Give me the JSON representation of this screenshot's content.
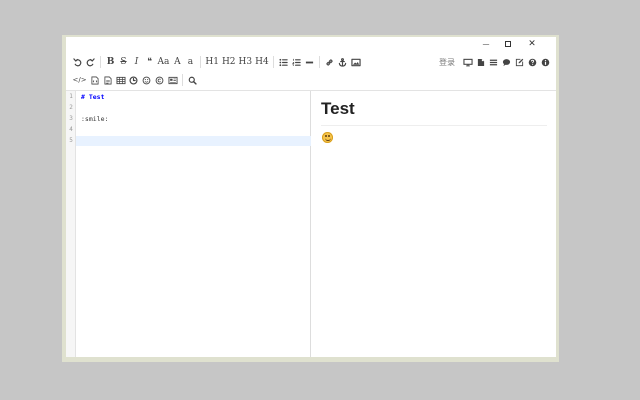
{
  "window": {
    "controls": {
      "minimize": "—",
      "close": "✕"
    }
  },
  "toolbar": {
    "row1": [
      {
        "name": "undo-button",
        "icon": "undo-icon"
      },
      {
        "name": "redo-button",
        "icon": "redo-icon"
      },
      {
        "sep": true
      },
      {
        "name": "bold-button",
        "label": "B",
        "style": "bold serif"
      },
      {
        "name": "strikethrough-button",
        "label": "S",
        "style": "strike serif"
      },
      {
        "name": "italic-button",
        "label": "I",
        "style": "italic serif"
      },
      {
        "name": "quote-button",
        "label": "❝",
        "style": ""
      },
      {
        "name": "uppercase-button",
        "label": "Aa",
        "style": "serif"
      },
      {
        "name": "capitalize-button",
        "label": "A",
        "style": "serif"
      },
      {
        "name": "lowercase-button",
        "label": "a",
        "style": "serif"
      },
      {
        "sep": true
      },
      {
        "name": "h1-button",
        "label": "H1",
        "style": "serif"
      },
      {
        "name": "h2-button",
        "label": "H2",
        "style": "serif"
      },
      {
        "name": "h3-button",
        "label": "H3",
        "style": "serif"
      },
      {
        "name": "h4-button",
        "label": "H4",
        "style": "serif"
      },
      {
        "sep": true
      },
      {
        "name": "unordered-list-button",
        "icon": "list-ul-icon"
      },
      {
        "name": "ordered-list-button",
        "icon": "list-ol-icon"
      },
      {
        "name": "horizontal-rule-button",
        "icon": "minus-icon"
      },
      {
        "sep": true
      },
      {
        "name": "link-button",
        "icon": "link-icon"
      },
      {
        "name": "anchor-button",
        "icon": "anchor-icon"
      },
      {
        "name": "image-button",
        "icon": "image-icon"
      }
    ],
    "row2": [
      {
        "name": "code-button",
        "label": "</>",
        "style": "small"
      },
      {
        "name": "code-block-button",
        "icon": "file-code-icon"
      },
      {
        "name": "preformatted-button",
        "icon": "file-text-icon"
      },
      {
        "name": "table-button",
        "icon": "table-icon"
      },
      {
        "name": "datetime-button",
        "icon": "clock-icon"
      },
      {
        "name": "emoji-button",
        "icon": "smile-icon"
      },
      {
        "name": "html-entities-button",
        "icon": "copyright-icon"
      },
      {
        "name": "pagebreak-button",
        "icon": "newspaper-icon"
      },
      {
        "sep": true
      },
      {
        "name": "search-button",
        "icon": "search-icon"
      }
    ],
    "right": {
      "login_label": "登录",
      "tools": [
        {
          "name": "watch-button",
          "icon": "desktop-icon"
        },
        {
          "name": "preview-button",
          "icon": "file-icon"
        },
        {
          "name": "fullscreen-button",
          "icon": "menu-icon"
        },
        {
          "name": "comment-button",
          "icon": "comment-icon"
        },
        {
          "name": "edit-button",
          "icon": "edit-icon"
        },
        {
          "name": "help-button",
          "icon": "question-icon"
        },
        {
          "name": "info-button",
          "icon": "info-icon"
        }
      ]
    }
  },
  "editor": {
    "line_numbers": [
      "1",
      "2",
      "3",
      "4",
      "5"
    ],
    "lines": [
      "# Test",
      "",
      ":smile:",
      "",
      ""
    ]
  },
  "preview": {
    "heading": "Test",
    "emoji_icon": "smile-emoji-icon"
  }
}
